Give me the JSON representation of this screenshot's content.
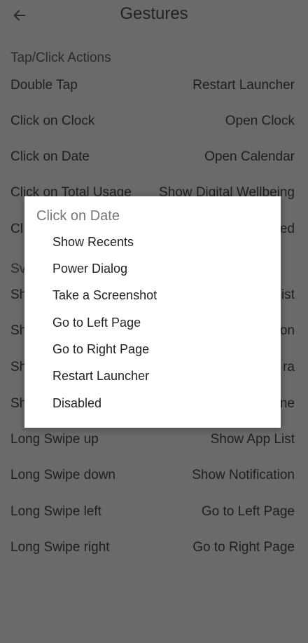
{
  "header": {
    "title": "Gestures"
  },
  "tap_section": {
    "title": "Tap/Click Actions",
    "rows": [
      {
        "label": "Double Tap",
        "value": "Restart Launcher"
      },
      {
        "label": "Click on Clock",
        "value": "Open Clock"
      },
      {
        "label": "Click on Date",
        "value": "Open Calendar"
      },
      {
        "label": "Click on Total Usage",
        "value": "Show Digital Wellbeing"
      },
      {
        "label": "Cl",
        "value": "ed"
      }
    ]
  },
  "swipe_section": {
    "title": "Sv",
    "rows": [
      {
        "label": "Sh",
        "value": "ist"
      },
      {
        "label": "Sh",
        "value": "on"
      },
      {
        "label": "Sh",
        "value": "ra"
      },
      {
        "label": "Sh",
        "value": "ne"
      },
      {
        "label": "Long Swipe up",
        "value": "Show App List"
      },
      {
        "label": "Long Swipe down",
        "value": "Show Notification"
      },
      {
        "label": "Long Swipe left",
        "value": "Go to Left Page"
      },
      {
        "label": "Long Swipe right",
        "value": "Go to Right Page"
      }
    ]
  },
  "dialog": {
    "title": "Click on Date",
    "options": [
      "Show Recents",
      "Power Dialog",
      "Take a Screenshot",
      "Go to Left Page",
      "Go to Right Page",
      "Restart Launcher",
      "Disabled"
    ]
  },
  "icons": {
    "back": "arrow-left"
  }
}
